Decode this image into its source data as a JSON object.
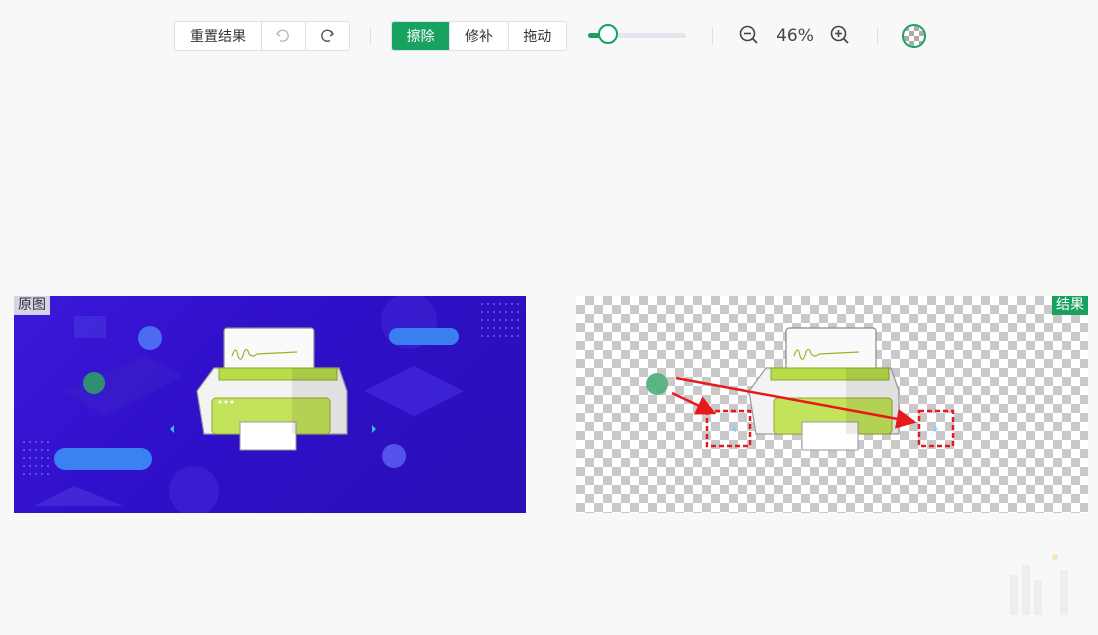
{
  "toolbar": {
    "reset_label": "重置结果",
    "undo_icon": "undo-icon",
    "redo_icon": "redo-icon",
    "modes": [
      "擦除",
      "修补",
      "拖动"
    ],
    "active_mode": "擦除",
    "brush_size_fraction": 0.2,
    "zoom_out_icon": "zoom-out-icon",
    "zoom_in_icon": "zoom-in-icon",
    "zoom_label": "46%",
    "transparent_bg_icon": "checkerboard-icon"
  },
  "panels": {
    "original_label": "原图",
    "result_label": "结果"
  },
  "colors": {
    "accent": "#19a15f",
    "original_bg": "#3218d0",
    "annotation": "#e8191b"
  }
}
